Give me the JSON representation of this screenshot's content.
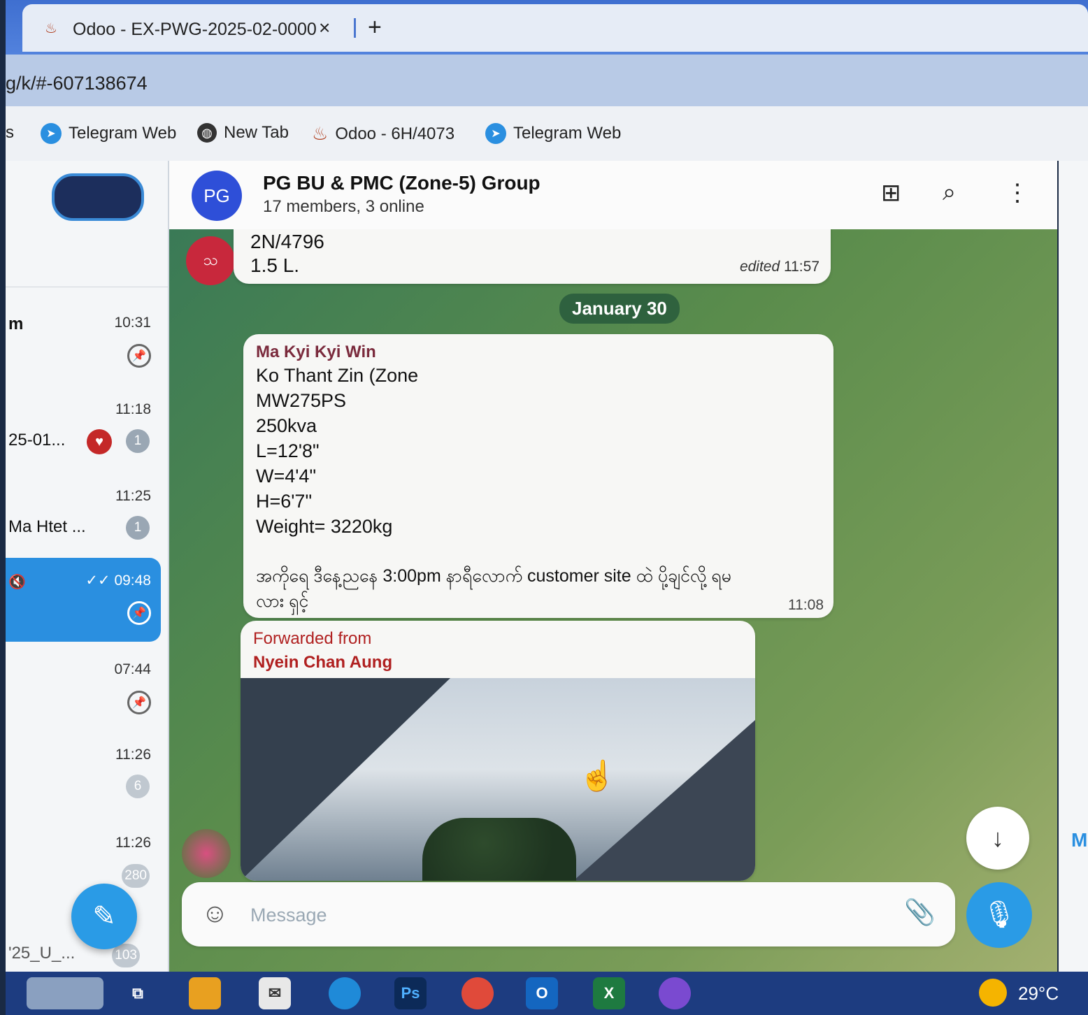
{
  "browser": {
    "tab_title": "Odoo - EX-PWG-2025-02-0000",
    "close_glyph": "×",
    "new_tab_glyph": "+",
    "address": "g/k/#-607138674"
  },
  "bookmarks": {
    "partial": "s",
    "items": [
      "Telegram Web",
      "New Tab",
      "Odoo - 6H/4073",
      "Telegram Web"
    ]
  },
  "sidebar": {
    "chats": [
      {
        "name": "m",
        "time": "10:31",
        "pinned": true
      },
      {
        "name": "25-01...",
        "time": "11:18",
        "badge": "1",
        "heart": true
      },
      {
        "name": "Ma Htet ...",
        "time": "11:25",
        "badge": "1"
      },
      {
        "name": "",
        "time": "09:48",
        "pinned": true,
        "active": true,
        "read": "✓✓"
      },
      {
        "name": "",
        "time": "07:44",
        "pinned": true
      },
      {
        "name": "",
        "time": "11:26",
        "badge": "6"
      },
      {
        "name": "",
        "time": "11:26",
        "badge": "280"
      },
      {
        "name": "'25_U_...",
        "time": "",
        "badge": "103"
      }
    ]
  },
  "chat": {
    "avatar_text": "PG",
    "title": "PG BU & PMC (Zone-5) Group",
    "subtitle": "17 members, 3 online",
    "prev_message": {
      "avatar_text": "သ",
      "lines": [
        "2N/4796",
        "1.5 L."
      ],
      "edited": "edited",
      "time": "11:57"
    },
    "date_separator": "January 30",
    "message": {
      "sender": "Ma Kyi Kyi Win",
      "lines": [
        "Ko Thant Zin (Zone",
        "MW275PS",
        "250kva",
        "L=12'8\"",
        "W=4'4\"",
        "H=6'7\"",
        "Weight= 3220kg",
        "",
        "အကိုရေ ဒီနေ့ညနေ 3:00pm နာရီလောက် customer site ထဲ ပို့ချင်လို့ ရမ",
        "လား ရှင့်"
      ],
      "time": "11:08"
    },
    "forwarded": {
      "label": "Forwarded from",
      "name": "Nyein Chan Aung"
    },
    "composer_placeholder": "Message"
  },
  "right_panel": {
    "partial": "M"
  },
  "taskbar": {
    "weather": "29°C",
    "apps": [
      "Ps",
      "O",
      "X"
    ]
  },
  "colors": {
    "telegram_blue": "#2a8fe0",
    "group_avatar": "#2e4fd8",
    "sender_name": "#7a2a3c",
    "forward_text": "#b02020"
  }
}
